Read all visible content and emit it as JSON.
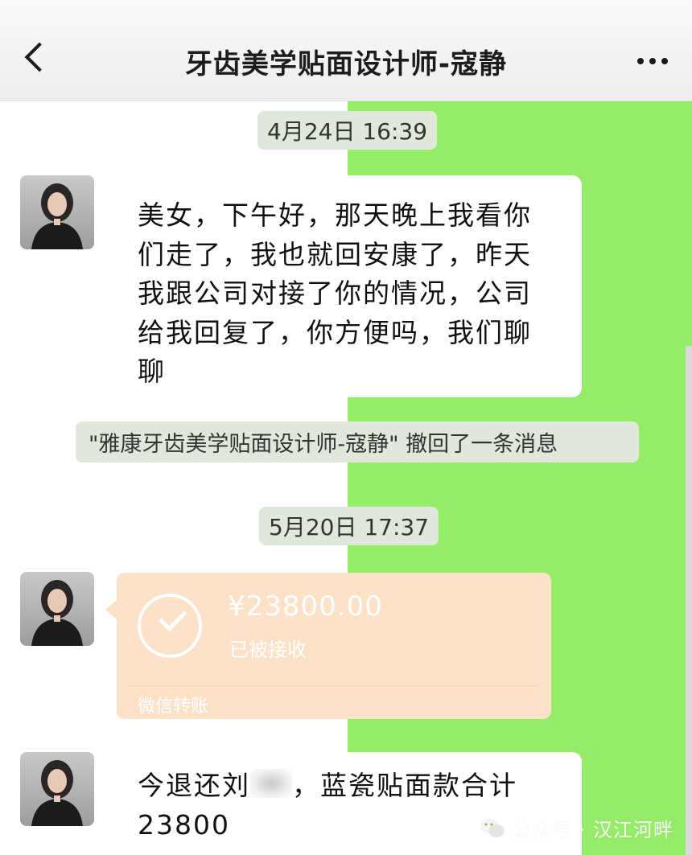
{
  "header": {
    "title": "牙齿美学贴面设计师-寇静"
  },
  "messages": {
    "time1": "4月24日 16:39",
    "msg1_lines": [
      "美女，下午好，那天晚上我看你",
      "们走了，我也就回安康了，昨天",
      "我跟公司对接了你的情况，公司",
      "给我回复了，你方便吗，我们聊",
      "聊"
    ],
    "recall_notice": "\"雅康牙齿美学贴面设计师-寇静\" 撤回了一条消息",
    "time2": "5月20日 17:37",
    "transfer": {
      "amount": "¥23800.00",
      "status": "已被接收",
      "label": "微信转账"
    },
    "msg3_line1_prefix": "今退还刘",
    "msg3_line1_suffix": "，蓝瓷贴面款合计",
    "msg3_line2": "23800"
  },
  "footer": {
    "watermark": "公众号 · 汉江河畔"
  },
  "colors": {
    "green_background": "#95ec69",
    "transfer_bubble": "#fde2c8",
    "header_bg": "#f2f2f2"
  },
  "icons": [
    "back-chevron-icon",
    "more-dots-icon",
    "check-circle-icon",
    "wechat-icon"
  ]
}
